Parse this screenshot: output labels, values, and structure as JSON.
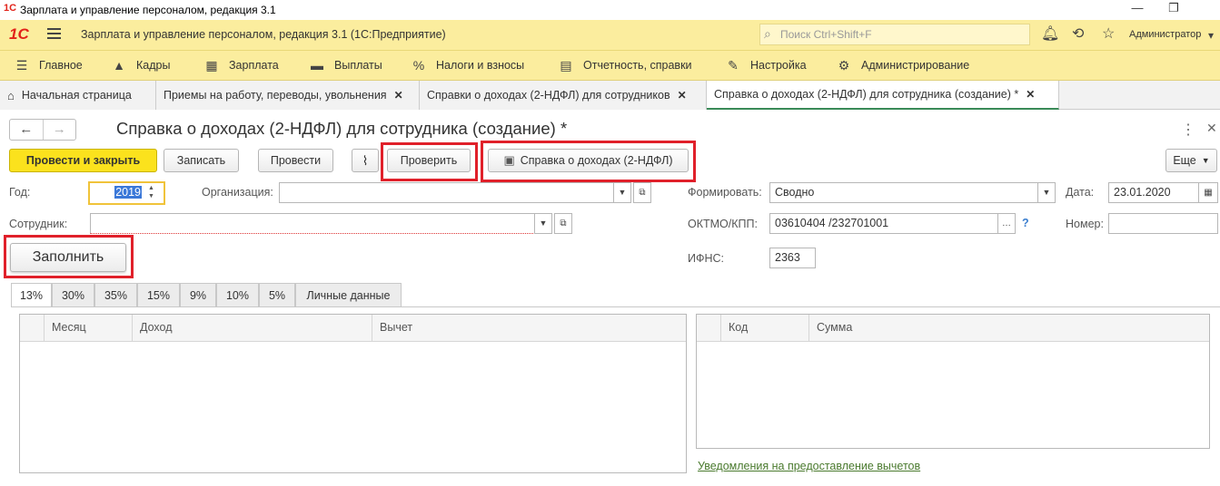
{
  "window": {
    "title": "Зарплата и управление персоналом, редакция 3.1",
    "logo": "1С",
    "min_icon": "minimize-icon",
    "restore_icon": "restore-icon"
  },
  "app_header": {
    "logo": "1С",
    "title": "Зарплата и управление персоналом, редакция 3.1  (1С:Предприятие)",
    "search_placeholder": "Поиск Ctrl+Shift+F",
    "user": "Администратор"
  },
  "sections": [
    {
      "label": "Главное",
      "icon": "☰"
    },
    {
      "label": "Кадры",
      "icon": "👥"
    },
    {
      "label": "Зарплата",
      "icon": "▦"
    },
    {
      "label": "Выплаты",
      "icon": "▬"
    },
    {
      "label": "Налоги и взносы",
      "icon": "%"
    },
    {
      "label": "Отчетность, справки",
      "icon": "▤"
    },
    {
      "label": "Настройка",
      "icon": "🔧"
    },
    {
      "label": "Администрирование",
      "icon": "⚙"
    }
  ],
  "open_tabs": [
    {
      "label": "Начальная страница"
    },
    {
      "label": "Приемы на работу, переводы, увольнения"
    },
    {
      "label": "Справки о доходах (2-НДФЛ) для сотрудников"
    },
    {
      "label": "Справка о доходах (2-НДФЛ) для сотрудника (создание) *"
    }
  ],
  "form": {
    "title": "Справка о доходах (2-НДФЛ) для сотрудника (создание) *",
    "toolbar": {
      "post_close": "Провести и закрыть",
      "save": "Записать",
      "post": "Провести",
      "check": "Проверить",
      "print": "Справка о доходах (2-НДФЛ)",
      "more": "Еще"
    },
    "year_label": "Год:",
    "year": "2019",
    "org_label": "Организация:",
    "org": "",
    "form_type_label": "Формировать:",
    "form_type": "Сводно",
    "date_label": "Дата:",
    "date": "23.01.2020",
    "employee_label": "Сотрудник:",
    "employee": "",
    "oktmo_label": "ОКТМО/КПП:",
    "oktmo": "03610404   /232701001",
    "help": "?",
    "number_label": "Номер:",
    "number": "",
    "fill": "Заполнить",
    "ifns_label": "ИФНС:",
    "ifns": "2363"
  },
  "rate_tabs": [
    "13%",
    "30%",
    "35%",
    "15%",
    "9%",
    "10%",
    "5%",
    "Личные данные"
  ],
  "income_table": {
    "columns": [
      "Месяц",
      "Доход",
      "Вычет"
    ],
    "rows": []
  },
  "deduction_table": {
    "columns": [
      "Код",
      "Сумма"
    ],
    "rows": []
  },
  "notifications_link": "Уведомления на предоставление вычетов"
}
